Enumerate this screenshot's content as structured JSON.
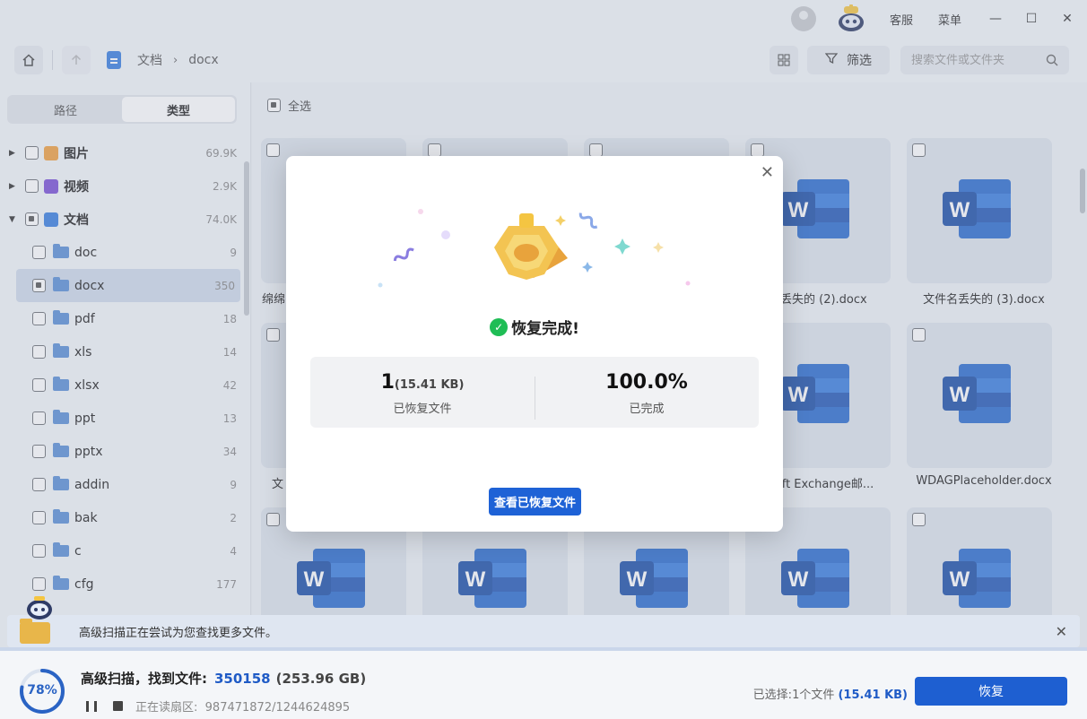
{
  "titlebar": {
    "service": "客服",
    "menu": "菜单",
    "minimize": "—",
    "maximize": "☐",
    "close": "✕"
  },
  "toolbar": {
    "breadcrumb": [
      "文档",
      "docx"
    ],
    "filter_label": "筛选",
    "search_placeholder": "搜索文件或文件夹"
  },
  "sidebar": {
    "tabs": [
      "路径",
      "类型"
    ],
    "active_tab": "类型",
    "categories": [
      {
        "label": "图片",
        "count": "69.9K",
        "color": "#f0a040"
      },
      {
        "label": "视频",
        "count": "2.9K",
        "color": "#7b4fd6"
      },
      {
        "label": "文档",
        "count": "74.0K",
        "color": "#3a7fe0"
      }
    ],
    "folders": [
      {
        "label": "doc",
        "count": "9"
      },
      {
        "label": "docx",
        "count": "350"
      },
      {
        "label": "pdf",
        "count": "18"
      },
      {
        "label": "xls",
        "count": "14"
      },
      {
        "label": "xlsx",
        "count": "42"
      },
      {
        "label": "ppt",
        "count": "13"
      },
      {
        "label": "pptx",
        "count": "34"
      },
      {
        "label": "addin",
        "count": "9"
      },
      {
        "label": "bak",
        "count": "2"
      },
      {
        "label": "c",
        "count": "4"
      },
      {
        "label": "cfg",
        "count": "177"
      }
    ]
  },
  "main": {
    "select_all": "全选",
    "file_names": [
      "绵绵",
      "名丢失的 (2).docx",
      "文件名丢失的 (3).docx",
      "文",
      "soft Exchange邮...",
      "WDAGPlaceholder.docx"
    ]
  },
  "notice": {
    "text": "高级扫描正在尝试为您查找更多文件。"
  },
  "status": {
    "progress_pct": "78%",
    "progress_value": 0.78,
    "scan_label": "高级扫描，找到文件:",
    "found_count": "350158",
    "found_size": "(253.96 GB)",
    "reading_label": "正在读扇区:",
    "reading_value": "987471872/1244624895",
    "selected_prefix": "已选择:",
    "selected_count": "1个文件",
    "selected_size": "(15.41 KB)",
    "recover_label": "恢复"
  },
  "modal": {
    "title": "恢复完成!",
    "recovered_count": "1",
    "recovered_size": "(15.41 KB)",
    "recovered_label": "已恢复文件",
    "percent": "100.0%",
    "percent_label": "已完成",
    "button": "查看已恢复文件"
  },
  "colors": {
    "accent": "#1e5fd1",
    "success": "#1fbd55",
    "word_blue": "#2b6ccf"
  }
}
